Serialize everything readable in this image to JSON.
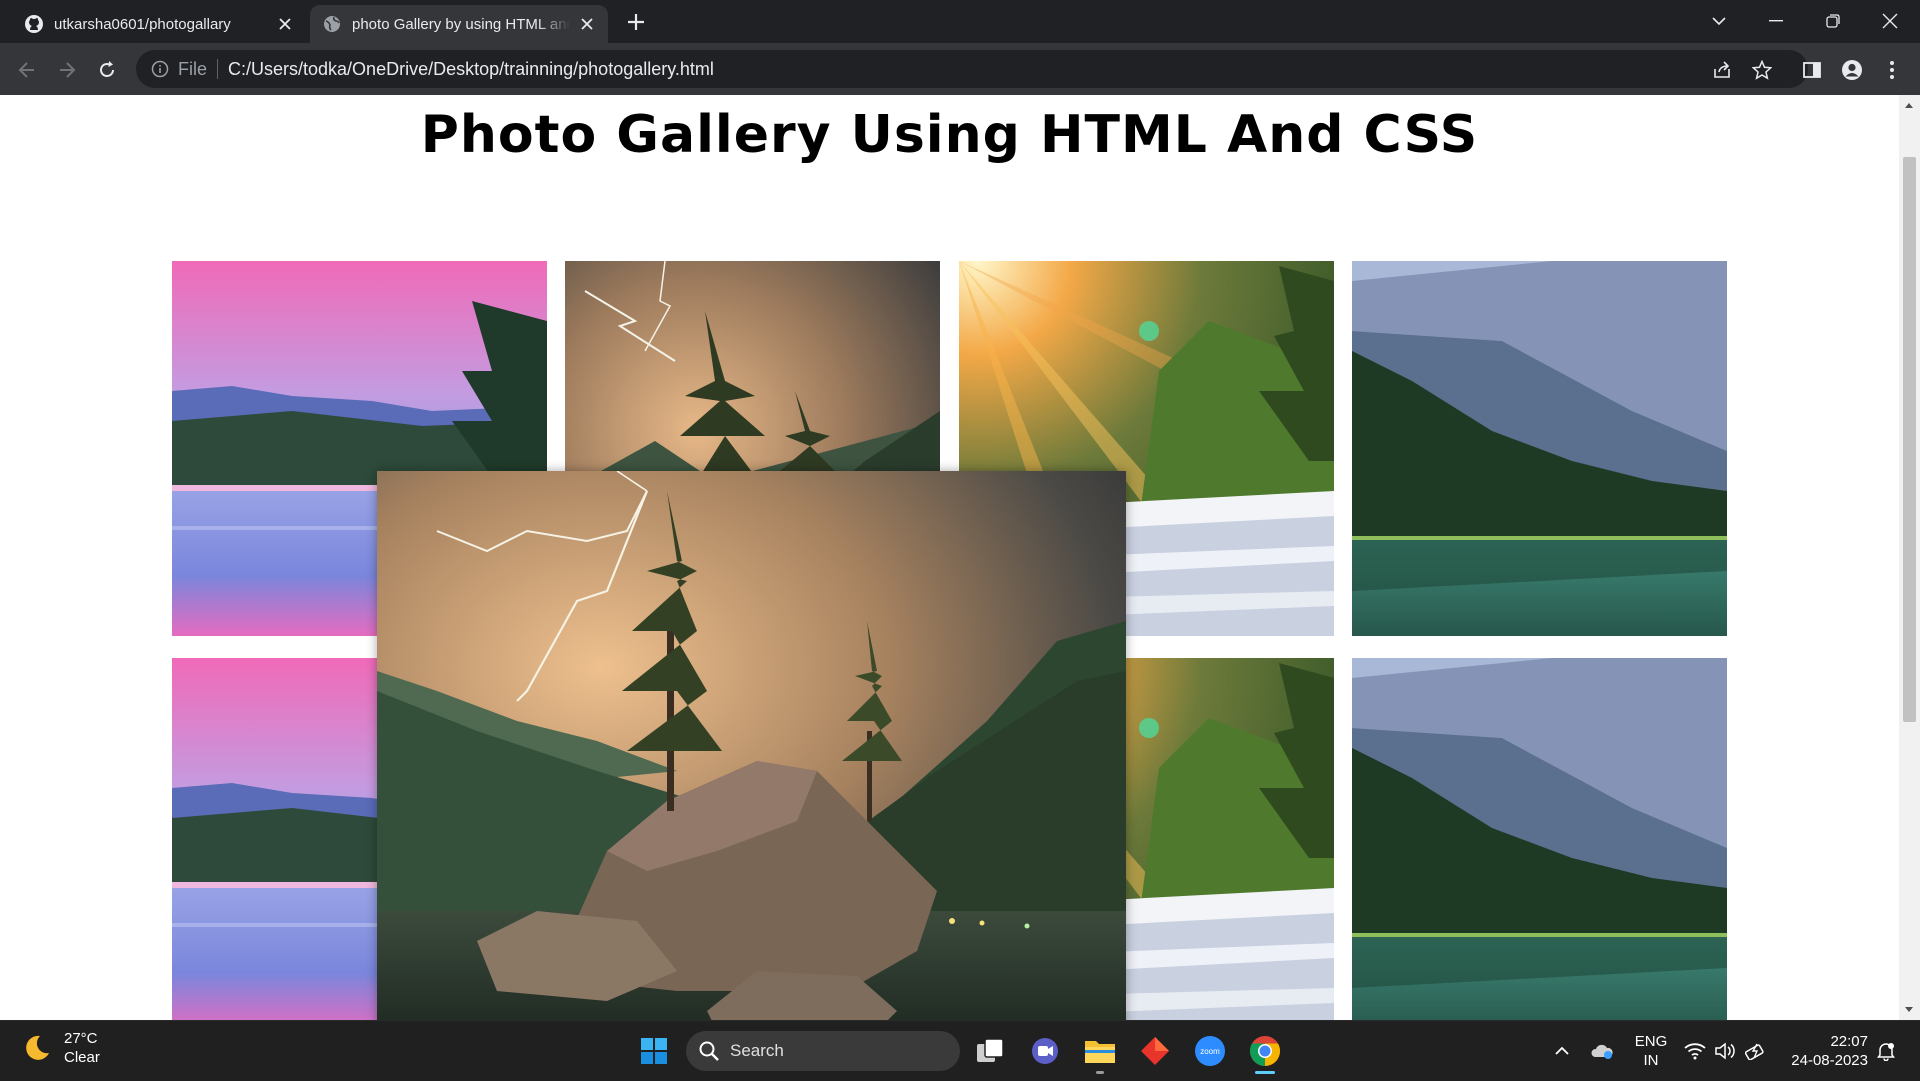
{
  "browser": {
    "tabs": [
      {
        "title": "utkarsha0601/photogallary",
        "favicon": "github-icon",
        "active": false
      },
      {
        "title": "photo Gallery by using HTML and CSS",
        "favicon": "globe-icon",
        "active": true
      }
    ],
    "omnibox": {
      "scheme": "File",
      "url": "C:/Users/todka/OneDrive/Desktop/trainning/photogallery.html"
    }
  },
  "page": {
    "title": "Photo Gallery Using HTML And CSS",
    "photos": [
      {
        "theme": "pink-sky-lake"
      },
      {
        "theme": "lightning-trees-rock"
      },
      {
        "theme": "sunburst-waterfall"
      },
      {
        "theme": "mountain-forest-lake"
      },
      {
        "theme": "pink-sky-lake"
      },
      {
        "theme": "lightning-trees-rock"
      },
      {
        "theme": "sunburst-waterfall"
      },
      {
        "theme": "mountain-forest-lake"
      }
    ],
    "zoomed_photo": {
      "theme": "lightning-trees-rock",
      "state": "hover-zoomed"
    }
  },
  "taskbar": {
    "weather": {
      "temp": "27°C",
      "condition": "Clear",
      "icon": "moon-icon"
    },
    "search_placeholder": "Search",
    "apps": [
      "windows-start-icon",
      "search-icon",
      "task-view-icon",
      "meet-icon",
      "file-explorer-icon",
      "app-diamond-icon",
      "zoom-icon",
      "chrome-icon"
    ],
    "tray": {
      "language_line1": "ENG",
      "language_line2": "IN",
      "time": "22:07",
      "date": "24-08-2023"
    }
  }
}
